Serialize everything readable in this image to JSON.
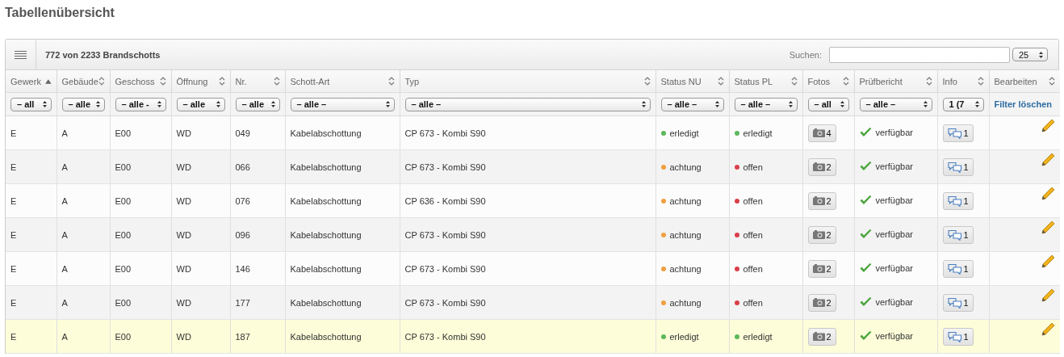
{
  "page_title": "Tabellenübersicht",
  "toolbar": {
    "count": "772 von 2233 Brandschotts",
    "search_label": "Suchen:",
    "page_size": "25"
  },
  "columns": [
    {
      "label": "Gewerk",
      "sorted": true,
      "filter": "– all"
    },
    {
      "label": "Gebäude",
      "sorted": false,
      "filter": "– alle"
    },
    {
      "label": "Geschoss",
      "sorted": false,
      "filter": "– alle -"
    },
    {
      "label": "Öffnung",
      "sorted": false,
      "filter": "– alle"
    },
    {
      "label": "Nr.",
      "sorted": false,
      "filter": "– alle"
    },
    {
      "label": "Schott-Art",
      "sorted": false,
      "filter": "– alle –"
    },
    {
      "label": "Typ",
      "sorted": false,
      "filter": "– alle –"
    },
    {
      "label": "Status NU",
      "sorted": false,
      "filter": "– alle –"
    },
    {
      "label": "Status PL",
      "sorted": false,
      "filter": "– alle –"
    },
    {
      "label": "Fotos",
      "sorted": false,
      "filter": "– all"
    },
    {
      "label": "Prüfbericht",
      "sorted": false,
      "filter": "– alle –"
    },
    {
      "label": "Info",
      "sorted": false,
      "filter": "1 (7"
    },
    {
      "label": "Bearbeiten",
      "sorted": false,
      "clear_filter": "Filter löschen"
    }
  ],
  "rows": [
    {
      "selected": false,
      "gewerk": "E",
      "gebaeude": "A",
      "geschoss": "E00",
      "oeffnung": "WD",
      "nr": "049",
      "schott_art": "Kabelabschottung",
      "typ": "CP 673 - Kombi S90",
      "status_nu": {
        "text": "erledigt",
        "color": "#5cb85c"
      },
      "status_pl": {
        "text": "erledigt",
        "color": "#5cb85c"
      },
      "fotos": "4",
      "pruefbericht": "verfügbar",
      "info": "1"
    },
    {
      "selected": false,
      "gewerk": "E",
      "gebaeude": "A",
      "geschoss": "E00",
      "oeffnung": "WD",
      "nr": "066",
      "schott_art": "Kabelabschottung",
      "typ": "CP 673 - Kombi S90",
      "status_nu": {
        "text": "achtung",
        "color": "#f0a040"
      },
      "status_pl": {
        "text": "offen",
        "color": "#d9404a"
      },
      "fotos": "2",
      "pruefbericht": "verfügbar",
      "info": "1"
    },
    {
      "selected": false,
      "gewerk": "E",
      "gebaeude": "A",
      "geschoss": "E00",
      "oeffnung": "WD",
      "nr": "076",
      "schott_art": "Kabelabschottung",
      "typ": "CP 636 - Kombi S90",
      "status_nu": {
        "text": "achtung",
        "color": "#f0a040"
      },
      "status_pl": {
        "text": "offen",
        "color": "#d9404a"
      },
      "fotos": "2",
      "pruefbericht": "verfügbar",
      "info": "1"
    },
    {
      "selected": false,
      "gewerk": "E",
      "gebaeude": "A",
      "geschoss": "E00",
      "oeffnung": "WD",
      "nr": "096",
      "schott_art": "Kabelabschottung",
      "typ": "CP 673 - Kombi S90",
      "status_nu": {
        "text": "achtung",
        "color": "#f0a040"
      },
      "status_pl": {
        "text": "offen",
        "color": "#d9404a"
      },
      "fotos": "2",
      "pruefbericht": "verfügbar",
      "info": "1"
    },
    {
      "selected": false,
      "gewerk": "E",
      "gebaeude": "A",
      "geschoss": "E00",
      "oeffnung": "WD",
      "nr": "146",
      "schott_art": "Kabelabschottung",
      "typ": "CP 673 - Kombi S90",
      "status_nu": {
        "text": "achtung",
        "color": "#f0a040"
      },
      "status_pl": {
        "text": "offen",
        "color": "#d9404a"
      },
      "fotos": "2",
      "pruefbericht": "verfügbar",
      "info": "1"
    },
    {
      "selected": false,
      "gewerk": "E",
      "gebaeude": "A",
      "geschoss": "E00",
      "oeffnung": "WD",
      "nr": "177",
      "schott_art": "Kabelabschottung",
      "typ": "CP 673 - Kombi S90",
      "status_nu": {
        "text": "achtung",
        "color": "#f0a040"
      },
      "status_pl": {
        "text": "offen",
        "color": "#d9404a"
      },
      "fotos": "2",
      "pruefbericht": "verfügbar",
      "info": "1"
    },
    {
      "selected": true,
      "gewerk": "E",
      "gebaeude": "A",
      "geschoss": "E00",
      "oeffnung": "WD",
      "nr": "187",
      "schott_art": "Kabelabschottung",
      "typ": "CP 673 - Kombi S90",
      "status_nu": {
        "text": "erledigt",
        "color": "#5cb85c"
      },
      "status_pl": {
        "text": "erledigt",
        "color": "#5cb85c"
      },
      "fotos": "2",
      "pruefbericht": "verfügbar",
      "info": "1"
    }
  ]
}
